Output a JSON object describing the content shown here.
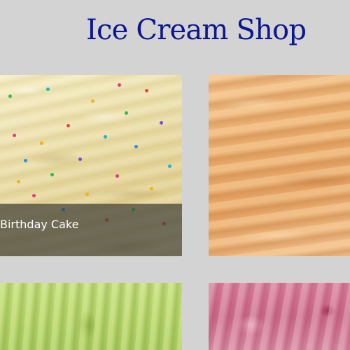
{
  "header": {
    "title": "Ice Cream Shop"
  },
  "flavors": [
    {
      "caption": "Birthday Cake",
      "image": "birthday-cake-ice-cream",
      "color": "#e9dca5"
    },
    {
      "caption": "",
      "image": "peach-caramel-ice-cream",
      "color": "#eaae70"
    },
    {
      "caption": "",
      "image": "green-tea-ice-cream",
      "color": "#b5d46d"
    },
    {
      "caption": "",
      "image": "strawberry-ice-cream",
      "color": "#d07891"
    }
  ],
  "colors": {
    "background": "#d3d3d3",
    "title": "#0b168f",
    "caption_overlay": "#404038",
    "caption_text": "#ffffff"
  }
}
